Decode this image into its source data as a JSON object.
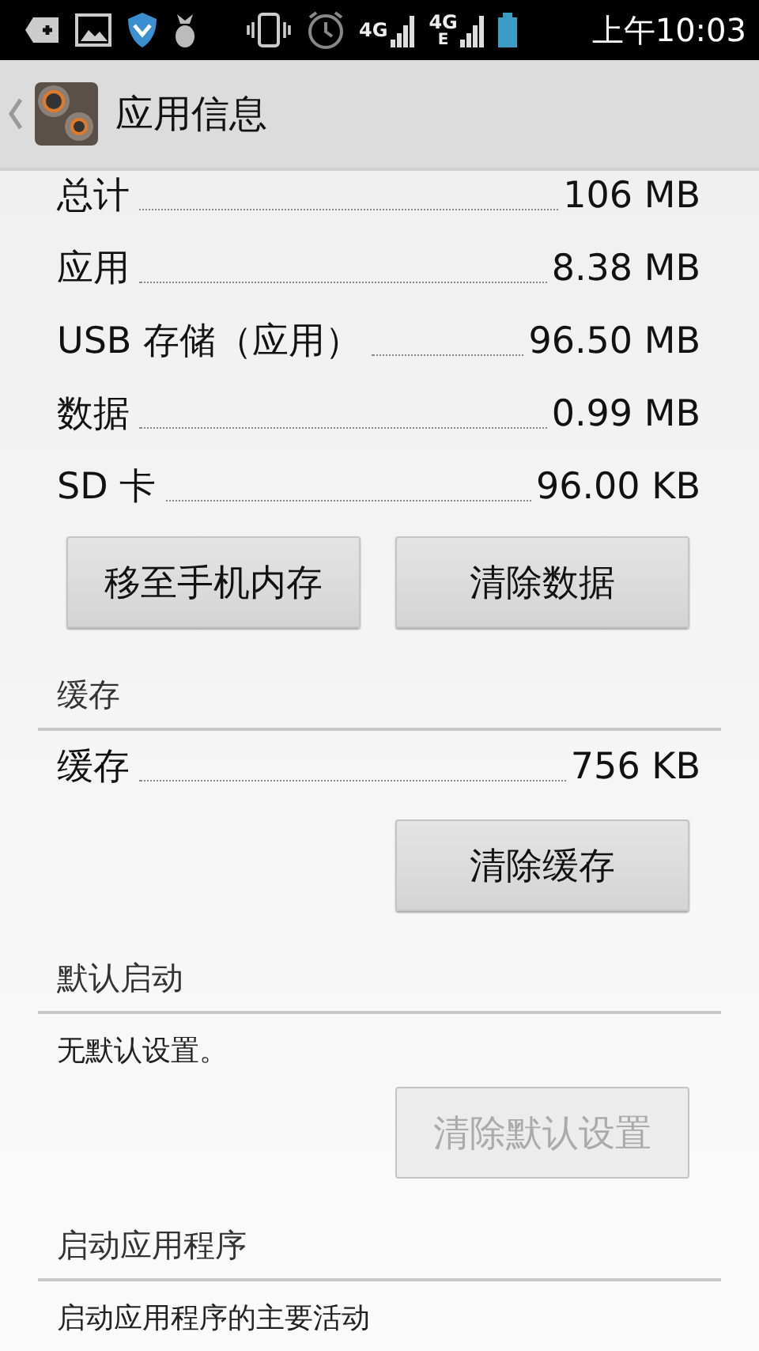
{
  "status_bar": {
    "network_labels": [
      {
        "top": "4G"
      },
      {
        "top": "4G",
        "bottom": "E"
      }
    ],
    "time": "上午10:03"
  },
  "header": {
    "title": "应用信息"
  },
  "sections": [
    {
      "rows": [
        {
          "label": "总计",
          "value": "106 MB"
        },
        {
          "label": "应用",
          "value": "8.38 MB"
        },
        {
          "label": "USB 存储（应用）",
          "value": "96.50 MB"
        },
        {
          "label": "数据",
          "value": "0.99 MB"
        },
        {
          "label": "SD 卡",
          "value": "96.00 KB"
        }
      ],
      "buttons": [
        {
          "label": "移至手机内存",
          "disabled": false
        },
        {
          "label": "清除数据",
          "disabled": false
        }
      ]
    },
    {
      "title": "缓存",
      "rows": [
        {
          "label": "缓存",
          "value": "756 KB"
        }
      ],
      "buttons": [
        {
          "label": "清除缓存",
          "disabled": false
        }
      ]
    },
    {
      "title": "默认启动",
      "text": "无默认设置。",
      "buttons": [
        {
          "label": "清除默认设置",
          "disabled": true
        }
      ]
    },
    {
      "title": "启动应用程序",
      "text": "启动应用程序的主要活动"
    }
  ]
}
